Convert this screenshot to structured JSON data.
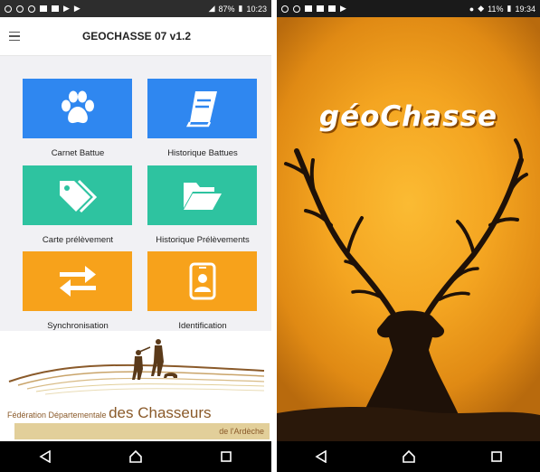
{
  "left_phone": {
    "status_time": "10:23",
    "status_battery": "87%",
    "app_title": "GEOCHASSE 07 v1.2",
    "tiles": [
      {
        "label": "Carnet Battue",
        "icon": "paw-icon",
        "color": "#2f87f0"
      },
      {
        "label": "Historique Battues",
        "icon": "book-icon",
        "color": "#2f87f0"
      },
      {
        "label": "Carte prélèvement",
        "icon": "tags-icon",
        "color": "#2ec3a0"
      },
      {
        "label": "Historique Prélèvements",
        "icon": "folder-icon",
        "color": "#2ec3a0"
      },
      {
        "label": "Synchronisation",
        "icon": "sync-arrows-icon",
        "color": "#f7a21b"
      },
      {
        "label": "Identification",
        "icon": "id-badge-icon",
        "color": "#f7a21b"
      }
    ],
    "federation": {
      "prefix": "Fédération Départementale",
      "name": "des Chasseurs",
      "region": "de l'Ardèche"
    }
  },
  "right_phone": {
    "status_time": "19:34",
    "status_battery": "11%",
    "brand": "géoChasse"
  }
}
